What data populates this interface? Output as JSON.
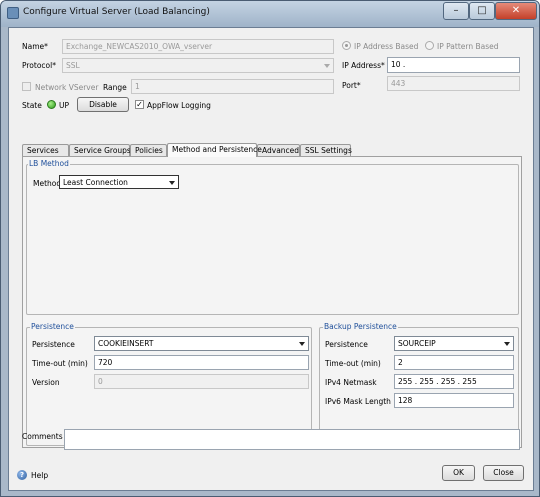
{
  "window": {
    "title": "Configure Virtual Server (Load Balancing)",
    "controls": {
      "minimize": "–",
      "maximize": "□",
      "close": "✕"
    }
  },
  "top": {
    "name_label": "Name*",
    "name_value": "Exchange_NEWCAS2010_OWA_vserver",
    "ip_based_label": "IP Address Based",
    "ip_pattern_label": "IP Pattern Based",
    "protocol_label": "Protocol*",
    "protocol_value": "SSL",
    "ip_address_label": "IP Address*",
    "ip_address_value": "10  .",
    "network_vserver_label": "Network VServer",
    "range_label": "Range",
    "range_value": "1",
    "port_label": "Port*",
    "port_value": "443",
    "state_label": "State",
    "state_value": "UP",
    "disable_button": "Disable",
    "appflow_label": "AppFlow Logging",
    "appflow_checked": "✓"
  },
  "tabs": [
    {
      "label": "Services"
    },
    {
      "label": "Service Groups"
    },
    {
      "label": "Policies"
    },
    {
      "label": "Method and Persistence"
    },
    {
      "label": "Advanced"
    },
    {
      "label": "SSL Settings"
    }
  ],
  "lb_method": {
    "group_label": "LB Method",
    "method_label": "Method",
    "method_value": "Least Connection"
  },
  "persistence": {
    "group_label": "Persistence",
    "persistence_label": "Persistence",
    "persistence_value": "COOKIEINSERT",
    "timeout_label": "Time-out (min)",
    "timeout_value": "720",
    "version_label": "Version",
    "version_value": "0"
  },
  "backup_persistence": {
    "group_label": "Backup Persistence",
    "persistence_label": "Persistence",
    "persistence_value": "SOURCEIP",
    "timeout_label": "Time-out (min)",
    "timeout_value": "2",
    "ipv4_label": "IPv4 Netmask",
    "ipv4_value": "255 . 255 . 255 . 255",
    "ipv6_label": "IPv6 Mask Length",
    "ipv6_value": "128"
  },
  "comments": {
    "label": "Comments",
    "value": ""
  },
  "footer": {
    "help_label": "Help",
    "ok_label": "OK",
    "close_label": "Close"
  },
  "colors": {
    "status_up": "#2a9a18",
    "group_label": "#1f4f9a",
    "title_bar": "#b3c4d7"
  }
}
